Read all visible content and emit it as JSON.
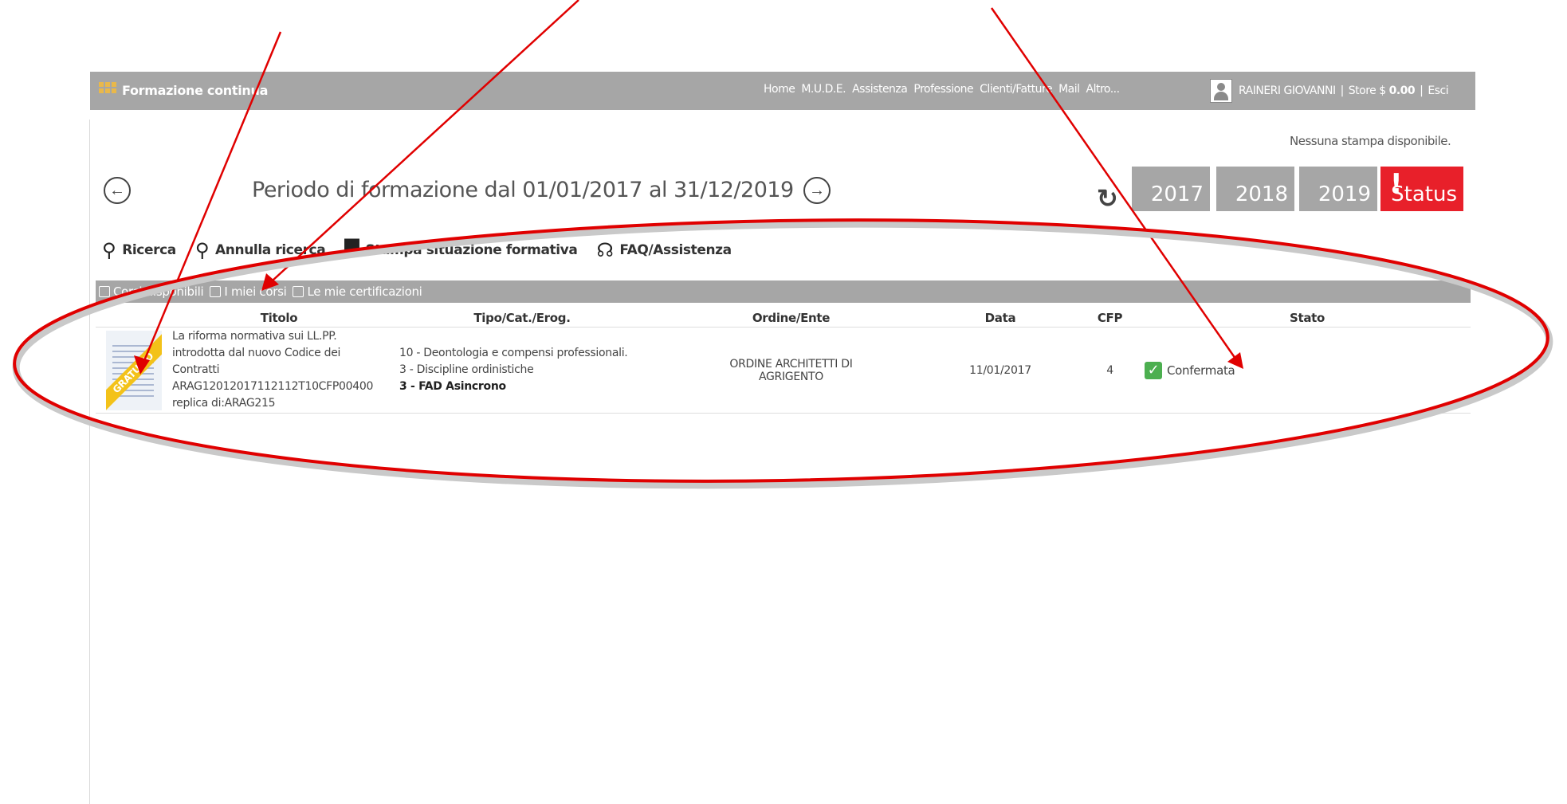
{
  "nav": {
    "app_title": "Formazione continua",
    "menu": [
      "Home",
      "M.U.D.E.",
      "Assistenza",
      "Professione",
      "Clienti/Fatture",
      "Mail",
      "Altro..."
    ],
    "user_name": "RAINERI GIOVANNI",
    "store_label": "Store $",
    "store_amount": "0.00",
    "logout": "Esci"
  },
  "notice": "Nessuna stampa disponibile.",
  "period": {
    "label": "Periodo di formazione dal 01/01/2017 al 31/12/2019",
    "years": [
      "2017",
      "2018",
      "2019"
    ],
    "status_label": "Status",
    "status_mark": "!"
  },
  "toolbar": {
    "search": "Ricerca",
    "cancel_search": "Annulla ricerca",
    "print": "Stampa situazione formativa",
    "faq": "FAQ/Assistenza"
  },
  "tabs": [
    "Corsi disponibili",
    "I miei corsi",
    "Le mie certificazioni"
  ],
  "table": {
    "headers": [
      "Titolo",
      "Tipo/Cat./Erog.",
      "Ordine/Ente",
      "Data",
      "CFP",
      "Stato"
    ],
    "rows": [
      {
        "ribbon": "GRATUITO",
        "title_lines": [
          "La riforma normativa sui LL.PP.",
          "introdotta dal nuovo Codice dei",
          "Contratti",
          "ARAG12012017112112T10CFP00400",
          "replica di:ARAG215"
        ],
        "tipo_lines": [
          "10 - Deontologia e compensi professionali.",
          "3 - Discipline ordinistiche"
        ],
        "tipo_bold": "3 - FAD Asincrono",
        "ente_lines": [
          "ORDINE ARCHITETTI DI",
          "AGRIGENTO"
        ],
        "data": "11/01/2017",
        "cfp": "4",
        "stato": "Confermata"
      }
    ]
  },
  "colors": {
    "nav_bg": "#a6a6a6",
    "status_red": "#e8202a",
    "annotation_red": "#e00000",
    "check_green": "#4caf50"
  }
}
